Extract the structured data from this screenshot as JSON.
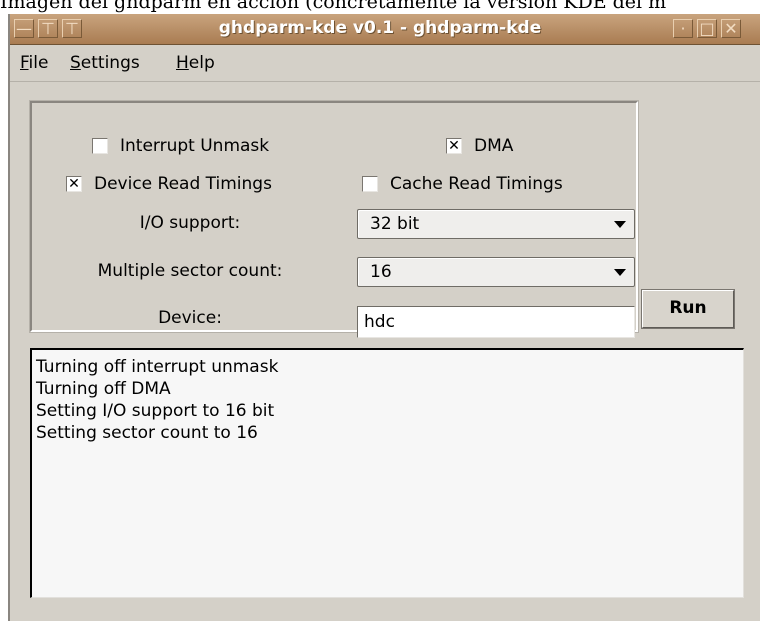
{
  "caption": {
    "text": "Imagen del ghdparm en acción (concretamente la versión KDE del m"
  },
  "window": {
    "title": "ghdparm-kde v0.1 - ghdparm-kde",
    "titlebar_left_buttons": [
      "—",
      "⊤",
      "⊤"
    ],
    "titlebar_right_buttons": [
      "·",
      "□",
      "✕"
    ]
  },
  "menu": {
    "file": {
      "mnemonic": "F",
      "rest": "ile"
    },
    "settings": {
      "mnemonic": "S",
      "rest": "ettings"
    },
    "help": {
      "mnemonic": "H",
      "rest": "elp"
    }
  },
  "options": {
    "interrupt_unmask": {
      "label": "Interrupt Unmask",
      "checked": false,
      "mark": ""
    },
    "dma": {
      "label": "DMA",
      "checked": true,
      "mark": "✕"
    },
    "device_read_timings": {
      "label": "Device Read Timings",
      "checked": true,
      "mark": "✕"
    },
    "cache_read_timings": {
      "label": "Cache Read Timings",
      "checked": false,
      "mark": ""
    }
  },
  "io_support": {
    "label": "I/O support:",
    "value": "32 bit"
  },
  "sector_count": {
    "label": "Multiple sector count:",
    "value": "16"
  },
  "device": {
    "label": "Device:",
    "value": "hdc"
  },
  "run_button": {
    "label": "Run"
  },
  "output": {
    "lines": [
      "Turning off interrupt unmask",
      "Turning off DMA",
      "Setting I/O support to 16 bit",
      "Setting sector count to 16"
    ]
  }
}
